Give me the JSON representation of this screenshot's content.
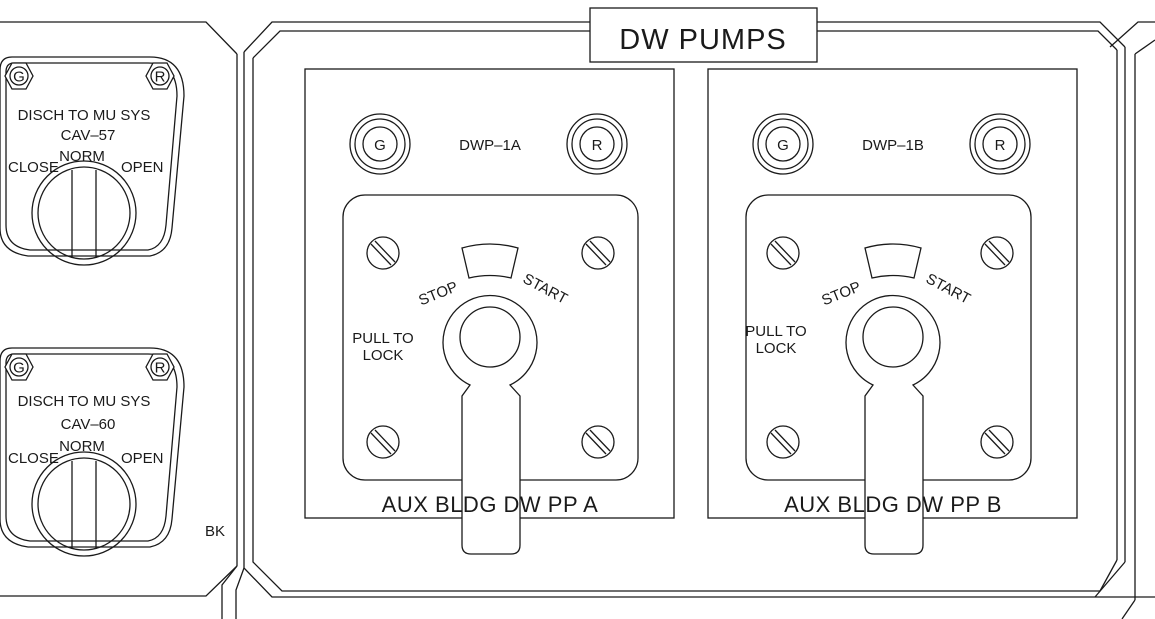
{
  "panel": {
    "title": "DW PUMPS",
    "marker": "BK"
  },
  "valves": [
    {
      "id": "cav57",
      "green_label": "G",
      "red_label": "R",
      "function": "DISCH TO MU SYS",
      "tag": "CAV–57",
      "pos_close": "CLOSE",
      "pos_norm": "NORM",
      "pos_open": "OPEN"
    },
    {
      "id": "cav60",
      "green_label": "G",
      "red_label": "R",
      "function": "DISCH TO MU SYS",
      "tag": "CAV–60",
      "pos_close": "CLOSE",
      "pos_norm": "NORM",
      "pos_open": "OPEN"
    }
  ],
  "pumps": [
    {
      "id": "a",
      "tag": "DWP–1A",
      "green_label": "G",
      "red_label": "R",
      "stop_label": "STOP",
      "start_label": "START",
      "pull_line1": "PULL TO",
      "pull_line2": "LOCK",
      "nameplate": "AUX BLDG DW PP  A"
    },
    {
      "id": "b",
      "tag": "DWP–1B",
      "green_label": "G",
      "red_label": "R",
      "stop_label": "STOP",
      "start_label": "START",
      "pull_line1": "PULL TO",
      "pull_line2": "LOCK",
      "nameplate": "AUX BLDG DW PP  B"
    }
  ],
  "colors": {
    "line": "#1a1a1a",
    "background": "#ffffff"
  }
}
